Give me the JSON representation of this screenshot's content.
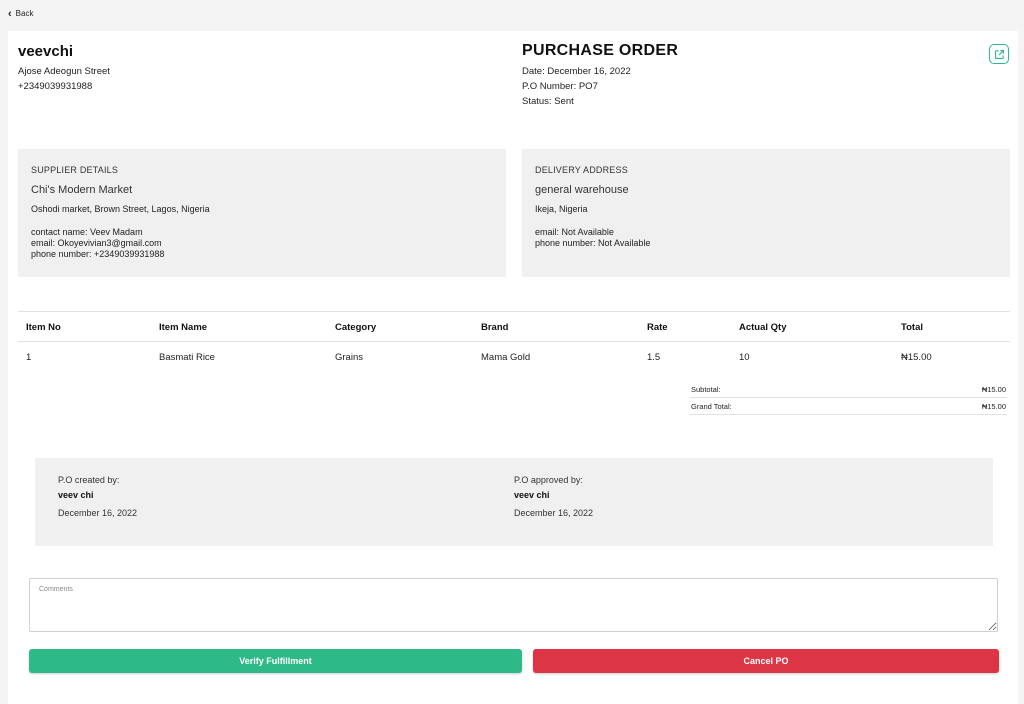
{
  "nav": {
    "back_label": "Back"
  },
  "business": {
    "name": "veevchi",
    "street": "Ajose Adeogun Street",
    "phone": "+2349039931988"
  },
  "po": {
    "title": "PURCHASE ORDER",
    "date": "Date: December 16, 2022",
    "number": "P.O Number: PO7",
    "status": "Status: Sent"
  },
  "supplier": {
    "heading": "SUPPLIER DETAILS",
    "name": "Chi's Modern Market",
    "address": "Oshodi market, Brown Street, Lagos, Nigeria",
    "contact_name": "contact name: Veev Madam",
    "email": "email: Okoyevivian3@gmail.com",
    "phone": "phone number: +2349039931988"
  },
  "delivery": {
    "heading": "DELIVERY ADDRESS",
    "name": "general warehouse",
    "address": "Ikeja, Nigeria",
    "email": "email: Not Available",
    "phone": "phone number: Not Available"
  },
  "table": {
    "headers": [
      "Item No",
      "Item Name",
      "Category",
      "Brand",
      "Rate",
      "Actual Qty",
      "Total"
    ],
    "rows": [
      [
        "1",
        "Basmati Rice",
        "Grains",
        "Mama Gold",
        "1.5",
        "10",
        "₦15.00"
      ]
    ]
  },
  "summary": {
    "subtotal_label": "Subtotal:",
    "subtotal_value": "₦15.00",
    "grand_total_label": "Grand Total:",
    "grand_total_value": "₦15.00"
  },
  "approval": {
    "created_label": "P.O created by:",
    "created_by": "veev chi",
    "created_date": "December 16, 2022",
    "approved_label": "P.O approved by:",
    "approved_by": "veev chi",
    "approved_date": "December 16, 2022"
  },
  "comments": {
    "placeholder": "Comments",
    "value": ""
  },
  "actions": {
    "verify_label": "Verify Fulfillment",
    "cancel_label": "Cancel PO"
  },
  "colors": {
    "accent_green": "#2dba88",
    "danger_red": "#dc3545",
    "panel_gray": "#f0f0f0"
  }
}
